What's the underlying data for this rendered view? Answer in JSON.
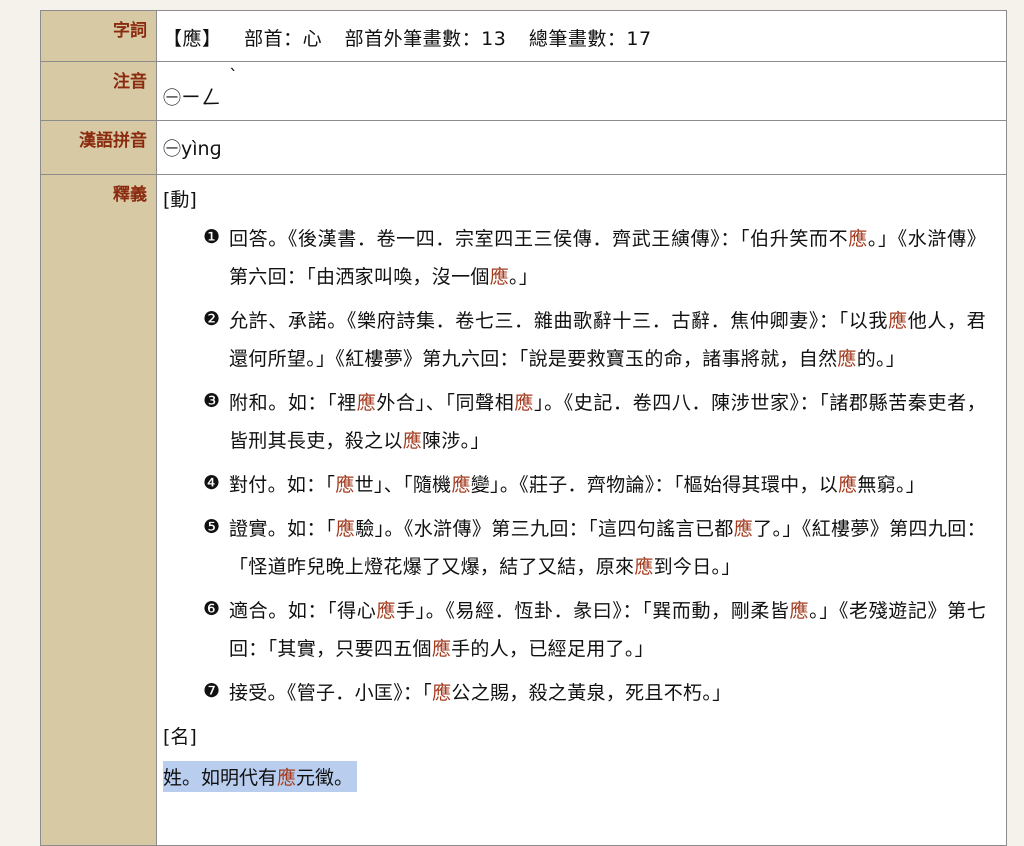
{
  "labels": {
    "word": "字詞",
    "zhuyin": "注音",
    "pinyin": "漢語拼音",
    "definition": "釋義"
  },
  "word": {
    "char": "【應】",
    "radical": "部首：心",
    "strokes_outside": "部首外筆畫數：13",
    "total_strokes": "總筆畫數：17"
  },
  "zhuyin": {
    "marker": "㊀",
    "symbols": "ㄧㄥ",
    "tone": "ˋ"
  },
  "pinyin": {
    "marker": "㊀",
    "text": "yìnɡ"
  },
  "definition": {
    "verb_pos": "[動]",
    "senses": [
      {
        "num": "❶",
        "parts": [
          "回答。《後漢書．卷一四．宗室四王三侯傳．齊武王縯傳》：「伯升笑而不",
          "應",
          "。」《水滸傳》第六回：「由洒家叫喚，沒一個",
          "應",
          "。」"
        ]
      },
      {
        "num": "❷",
        "parts": [
          "允許、承諾。《樂府詩集．卷七三．雜曲歌辭十三．古辭．焦仲卿妻》：「以我",
          "應",
          "他人，君還何所望。」《紅樓夢》第九六回：「說是要救寶玉的命，諸事將就，自然",
          "應",
          "的。」"
        ]
      },
      {
        "num": "❸",
        "parts": [
          "附和。如：「裡",
          "應",
          "外合」、「同聲相",
          "應",
          "」。《史記．卷四八．陳涉世家》：「諸郡縣苦秦吏者，皆刑其長吏，殺之以",
          "應",
          "陳涉。」"
        ]
      },
      {
        "num": "❹",
        "parts": [
          "對付。如：「",
          "應",
          "世」、「隨機",
          "應",
          "變」。《莊子．齊物論》：「樞始得其環中，以",
          "應",
          "無窮。」"
        ]
      },
      {
        "num": "❺",
        "parts": [
          "證實。如：「",
          "應",
          "驗」。《水滸傳》第三九回：「這四句謠言已都",
          "應",
          "了。」《紅樓夢》第四九回：「怪道昨兒晚上燈花爆了又爆，結了又結，原來",
          "應",
          "到今日。」"
        ]
      },
      {
        "num": "❻",
        "parts": [
          "適合。如：「得心",
          "應",
          "手」。《易經．恆卦．彖曰》：「巽而動，剛柔皆",
          "應",
          "。」《老殘遊記》第七回：「其實，只要四五個",
          "應",
          "手的人，已經足用了。」"
        ]
      },
      {
        "num": "❼",
        "parts": [
          "接受。《管子．小匡》：「",
          "應",
          "公之賜，殺之黃泉，死且不朽。」"
        ]
      }
    ],
    "noun_pos": "[名]",
    "noun_def": {
      "parts": [
        "姓。如明代有",
        "應",
        "元徵。"
      ]
    }
  },
  "colors": {
    "label_bg": "#d8c9a5",
    "label_text": "#8a2b10",
    "highlight_char": "#a33a1e",
    "selection": "#b9cdee"
  }
}
